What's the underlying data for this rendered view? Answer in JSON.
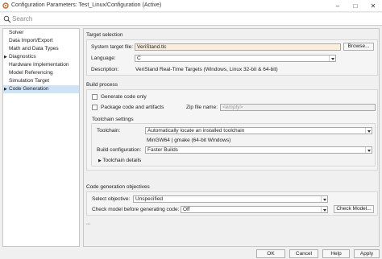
{
  "window": {
    "title": "Configuration Parameters: Test_Linux/Configuration (Active)",
    "minimize": "–",
    "maximize": "□",
    "close": "✕"
  },
  "search": {
    "placeholder": "Search"
  },
  "sidebar": {
    "items": [
      {
        "label": "Solver",
        "expandable": false,
        "selected": false
      },
      {
        "label": "Data Import/Export",
        "expandable": false,
        "selected": false
      },
      {
        "label": "Math and Data Types",
        "expandable": false,
        "selected": false
      },
      {
        "label": "Diagnostics",
        "expandable": true,
        "selected": false
      },
      {
        "label": "Hardware Implementation",
        "expandable": false,
        "selected": false
      },
      {
        "label": "Model Referencing",
        "expandable": false,
        "selected": false
      },
      {
        "label": "Simulation Target",
        "expandable": false,
        "selected": false
      },
      {
        "label": "Code Generation",
        "expandable": true,
        "selected": true
      }
    ]
  },
  "target_selection": {
    "heading": "Target selection",
    "system_target_file_label": "System target file:",
    "system_target_file_value": "VeriStand.tlc",
    "browse_button": "Browse...",
    "language_label": "Language:",
    "language_value": "C",
    "description_label": "Description:",
    "description_value": "VeriStand Real-Time Targets (Windows, Linux 32-bit & 64-bit)"
  },
  "build_process": {
    "heading": "Build process",
    "generate_code_only_label": "Generate code only",
    "generate_code_only_checked": false,
    "package_code_label": "Package code and artifacts",
    "package_code_checked": false,
    "zip_file_name_label": "Zip file name:",
    "zip_file_name_placeholder": "<empty>",
    "toolchain_settings": {
      "heading": "Toolchain settings",
      "toolchain_label": "Toolchain:",
      "toolchain_value": "Automatically locate an installed toolchain",
      "toolchain_resolved": "MinGW64 | gmake (64-bit Windows)",
      "build_config_label": "Build configuration:",
      "build_config_value": "Faster Builds",
      "toolchain_details_label": "Toolchain details"
    }
  },
  "objectives": {
    "heading": "Code generation objectives",
    "select_objective_label": "Select objective:",
    "select_objective_value": "Unspecified",
    "check_model_label": "Check model before generating code:",
    "check_model_value": "Off",
    "check_model_button": "Check Model...",
    "more": "..."
  },
  "footer": {
    "ok": "OK",
    "cancel": "Cancel",
    "help": "Help",
    "apply": "Apply"
  },
  "colors": {
    "selection": "#cfe3f7",
    "highlight_field": "#fbeedd",
    "window_bg": "#f0f0f0"
  }
}
